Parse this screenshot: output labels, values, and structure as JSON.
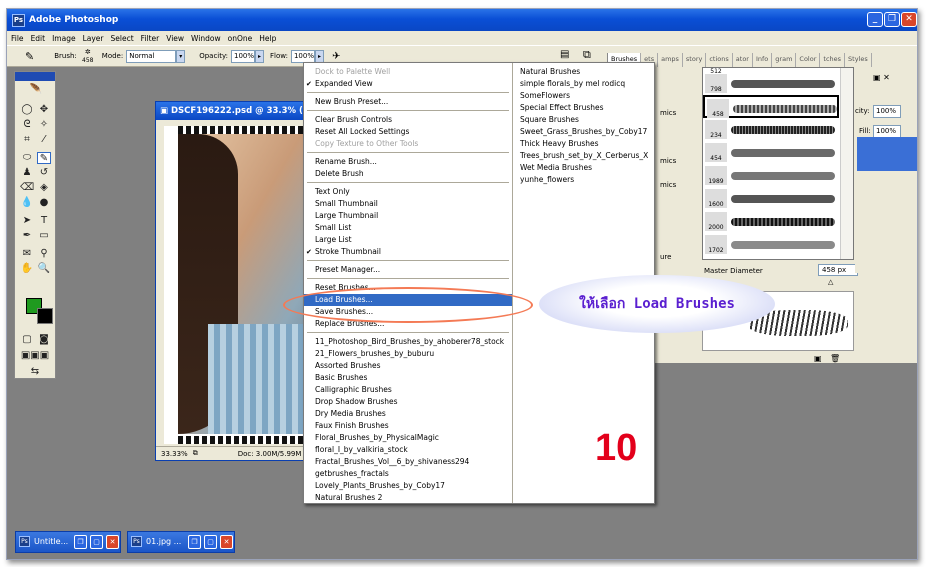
{
  "app_title": "Adobe Photoshop",
  "menubar": [
    "File",
    "Edit",
    "Image",
    "Layer",
    "Select",
    "Filter",
    "View",
    "Window",
    "onOne",
    "Help"
  ],
  "options": {
    "brush_label": "Brush:",
    "brush_size": "458",
    "mode_label": "Mode:",
    "mode_value": "Normal",
    "opacity_label": "Opacity:",
    "opacity_value": "100%",
    "flow_label": "Flow:",
    "flow_value": "100%"
  },
  "document": {
    "title": "DSCF196222.psd @ 33.3% (La",
    "zoom": "33.33%",
    "doc_size": "Doc: 3.00M/5.99M"
  },
  "brush_panel": {
    "tabs": [
      "Brushes",
      "ets",
      "amps",
      "story",
      "ctions",
      "ator",
      "Info",
      "gram",
      "Color",
      "tches",
      "Styles"
    ],
    "master_label": "Master Diameter",
    "master_value": "458 px",
    "brush_sizes": [
      "798",
      "458",
      "234",
      "454",
      "1989",
      "1600",
      "2000",
      "1702"
    ],
    "top_partial": "512"
  },
  "layers_side": {
    "opacity_label": "city:",
    "opacity_value": "100%",
    "fill_label": "Fill:",
    "fill_value": "100%"
  },
  "brush_side_labels": [
    "mics",
    "mics",
    "mics",
    "ure"
  ],
  "context_menu": {
    "col1": [
      {
        "label": "Dock to Palette Well",
        "disabled": true
      },
      {
        "label": "Expanded View",
        "checked": true
      },
      {
        "sep": true
      },
      {
        "label": "New Brush Preset..."
      },
      {
        "sep": true
      },
      {
        "label": "Clear Brush Controls"
      },
      {
        "label": "Reset All Locked Settings"
      },
      {
        "label": "Copy Texture to Other Tools",
        "disabled": true
      },
      {
        "sep": true
      },
      {
        "label": "Rename Brush..."
      },
      {
        "label": "Delete Brush"
      },
      {
        "sep": true
      },
      {
        "label": "Text Only"
      },
      {
        "label": "Small Thumbnail"
      },
      {
        "label": "Large Thumbnail"
      },
      {
        "label": "Small List"
      },
      {
        "label": "Large List"
      },
      {
        "label": "Stroke Thumbnail",
        "checked": true
      },
      {
        "sep": true
      },
      {
        "label": "Preset Manager..."
      },
      {
        "sep": true
      },
      {
        "label": "Reset Brushes..."
      },
      {
        "label": "Load Brushes...",
        "highlighted": true
      },
      {
        "label": "Save Brushes..."
      },
      {
        "label": "Replace Brushes..."
      },
      {
        "sep": true
      },
      {
        "label": "11_Photoshop_Bird_Brushes_by_ahoberer78_stock"
      },
      {
        "label": "21_Flowers_brushes_by_buburu"
      },
      {
        "label": "Assorted Brushes"
      },
      {
        "label": "Basic Brushes"
      },
      {
        "label": "Calligraphic Brushes"
      },
      {
        "label": "Drop Shadow Brushes"
      },
      {
        "label": "Dry Media Brushes"
      },
      {
        "label": "Faux Finish Brushes"
      },
      {
        "label": "Floral_Brushes_by_PhysicalMagic"
      },
      {
        "label": "floral_I_by_valkiria_stock"
      },
      {
        "label": "Fractal_Brushes_Vol__6_by_shivaness294"
      },
      {
        "label": "getbrushes_fractals"
      },
      {
        "label": "Lovely_Plants_Brushes_by_Coby17"
      },
      {
        "label": "Natural Brushes 2"
      }
    ],
    "col2": [
      "Natural Brushes",
      "simple florals_by mel rodicq",
      "SomeFlowers",
      "Special Effect Brushes",
      "Square Brushes",
      "Sweet_Grass_Brushes_by_Coby17",
      "Thick Heavy Brushes",
      "Trees_brush_set_by_X_Cerberus_X",
      "Wet Media Brushes",
      "yunhe_flowers"
    ]
  },
  "annotation": {
    "bubble_text": "ให้เลือก Load Brushes",
    "step_number": "10"
  },
  "taskbar": {
    "items": [
      "Untitle...",
      "01.jpg ..."
    ]
  },
  "colors": {
    "foreground": "#1f9a1f",
    "background": "#000000",
    "highlight": "#316ac5",
    "step_red": "#e3001b",
    "callout_orange": "#f47a55"
  }
}
